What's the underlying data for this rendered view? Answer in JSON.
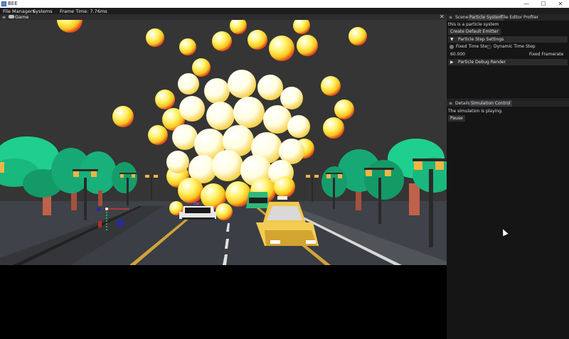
{
  "window": {
    "title": "BEE",
    "minimize_label": "—",
    "maximize_label": "☐",
    "close_label": "✕"
  },
  "menubar": {
    "items": [
      "File",
      "Managers",
      "Systems"
    ],
    "frame_time": "Frame Time: 7.76ms"
  },
  "game_panel": {
    "menu_icon": "≡",
    "label": "Game",
    "close_label": "✕"
  },
  "top_panel": {
    "menu_icon": "≡",
    "tabs": [
      "Scene",
      "Particle System",
      "Tile Editor",
      "Profiler"
    ],
    "active_tab": "Particle System",
    "description": "this is a particle system",
    "create_button": "Create Default Emitter",
    "step_settings": {
      "arrow": "▼",
      "label": "Particle Step Settings",
      "fixed_label": "Fixed Time Step",
      "dynamic_label": "Dynamic Time Step",
      "framerate_value": "60.000",
      "framerate_label": "Fixed Framerate"
    },
    "debug_render": {
      "arrow": "▶",
      "label": "Particle Debug Render"
    }
  },
  "bottom_panel": {
    "menu_icon": "≡",
    "tabs": [
      "Details",
      "Simulation Control"
    ],
    "status": "The simulation is playing.",
    "pause_button": "Pause"
  },
  "colors": {
    "title_bar": "#ffffff",
    "menu_bar": "#1d1d1f",
    "panel_bg": "#151515",
    "sky": "#353535",
    "road": "#3b3e44",
    "tree": "#1fcf8e",
    "taxi": "#f2c84b"
  }
}
